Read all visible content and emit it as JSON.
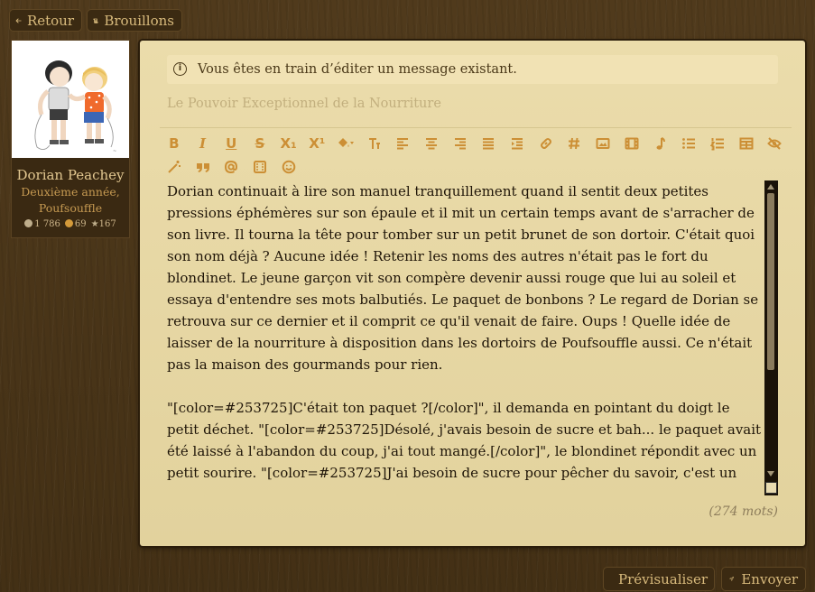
{
  "nav": {
    "back_label": "Retour",
    "drafts_label": "Brouillons"
  },
  "profile": {
    "name": "Dorian Peachey",
    "role_line1": "Deuxième année,",
    "role_line2": "Poufsouffle",
    "stats": {
      "messages": "1 786",
      "coins": "69",
      "stars": "167"
    }
  },
  "editor": {
    "notice": "Vous êtes en train d’éditer un message existant.",
    "title_placeholder": "Le Pouvoir Exceptionnel de la Nourriture",
    "toolbar_row1": [
      "B",
      "I",
      "U",
      "S",
      "X₁",
      "X¹"
    ],
    "body": "Dorian continuait à lire son manuel tranquillement quand il sentit deux petites pressions éphémères sur son épaule et il mit un certain temps avant de s'arracher de son livre. Il tourna la tête pour tomber sur un petit brunet de son dortoir. C'était quoi son nom déjà ? Aucune idée ! Retenir les noms des autres n'était pas le fort du blondinet. Le jeune garçon vit son compère devenir aussi rouge que lui au soleil et essaya d'entendre ses mots balbutiés. Le paquet de bonbons ? Le regard de Dorian se retrouva sur ce dernier et il comprit ce qu'il venait de faire. Oups ! Quelle idée de laisser de la nourriture à disposition dans les dortoirs de Poufsouffle aussi. Ce n'était pas la maison des gourmands pour rien.\n\n\"[color=#253725]C'était ton paquet ?[/color]\", il demanda en pointant du doigt le petit déchet. \"[color=#253725]Désolé, j'avais besoin de sucre et bah... le paquet avait été laissé à l'abandon du coup, j'ai tout mangé.[/color]\", le blondinet répondit avec un petit sourire. \"[color=#253725]J'ai besoin de sucre pour pêcher du savoir, c'est un peu comme un appât pour attirer les savoirs jusqu'à ma tête ou le carburant pour recharger mon énergie ![/color]\",",
    "word_count": "(274 mots)"
  },
  "actions": {
    "preview_label": "Prévisualiser",
    "send_label": "Envoyer"
  },
  "colors": {
    "accent": "#cc8f35",
    "background": "#4a3418",
    "panel": "#e6d8a6"
  }
}
